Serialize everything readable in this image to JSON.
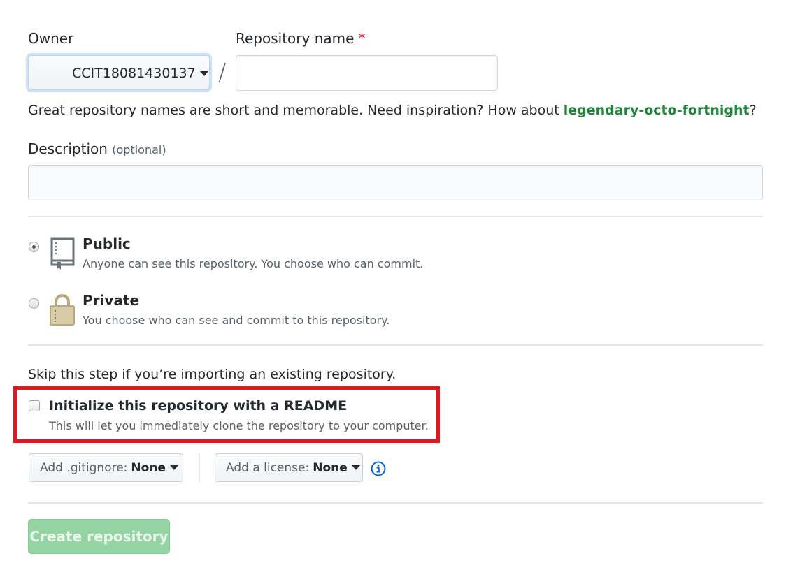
{
  "owner": {
    "label": "Owner",
    "value": "CCIT18081430137"
  },
  "repo_name": {
    "label": "Repository name",
    "required_marker": "*",
    "value": "",
    "placeholder": ""
  },
  "separator": "/",
  "name_hint": {
    "prefix": "Great repository names are short and memorable. Need inspiration? How about ",
    "suggestion": "legendary-octo-fortnight",
    "suffix": "?"
  },
  "description": {
    "label": "Description",
    "optional": "(optional)",
    "value": "",
    "placeholder": ""
  },
  "visibility": {
    "selected": "public",
    "options": [
      {
        "id": "public",
        "title": "Public",
        "desc": "Anyone can see this repository. You choose who can commit.",
        "icon": "repo-book-icon"
      },
      {
        "id": "private",
        "title": "Private",
        "desc": "You choose who can see and commit to this repository.",
        "icon": "lock-icon"
      }
    ]
  },
  "skip_text": "Skip this step if you’re importing an existing repository.",
  "init_readme": {
    "checked": false,
    "title": "Initialize this repository with a README",
    "desc": "This will let you immediately clone the repository to your computer."
  },
  "gitignore": {
    "prefix": "Add .gitignore:",
    "value": "None"
  },
  "license": {
    "prefix": "Add a license:",
    "value": "None"
  },
  "create_button": {
    "label": "Create repository",
    "disabled": true
  },
  "colors": {
    "highlight": "#e3151f",
    "suggestion": "#22863a",
    "create_disabled_bg": "#94d3a2",
    "info_blue": "#0366d6"
  }
}
